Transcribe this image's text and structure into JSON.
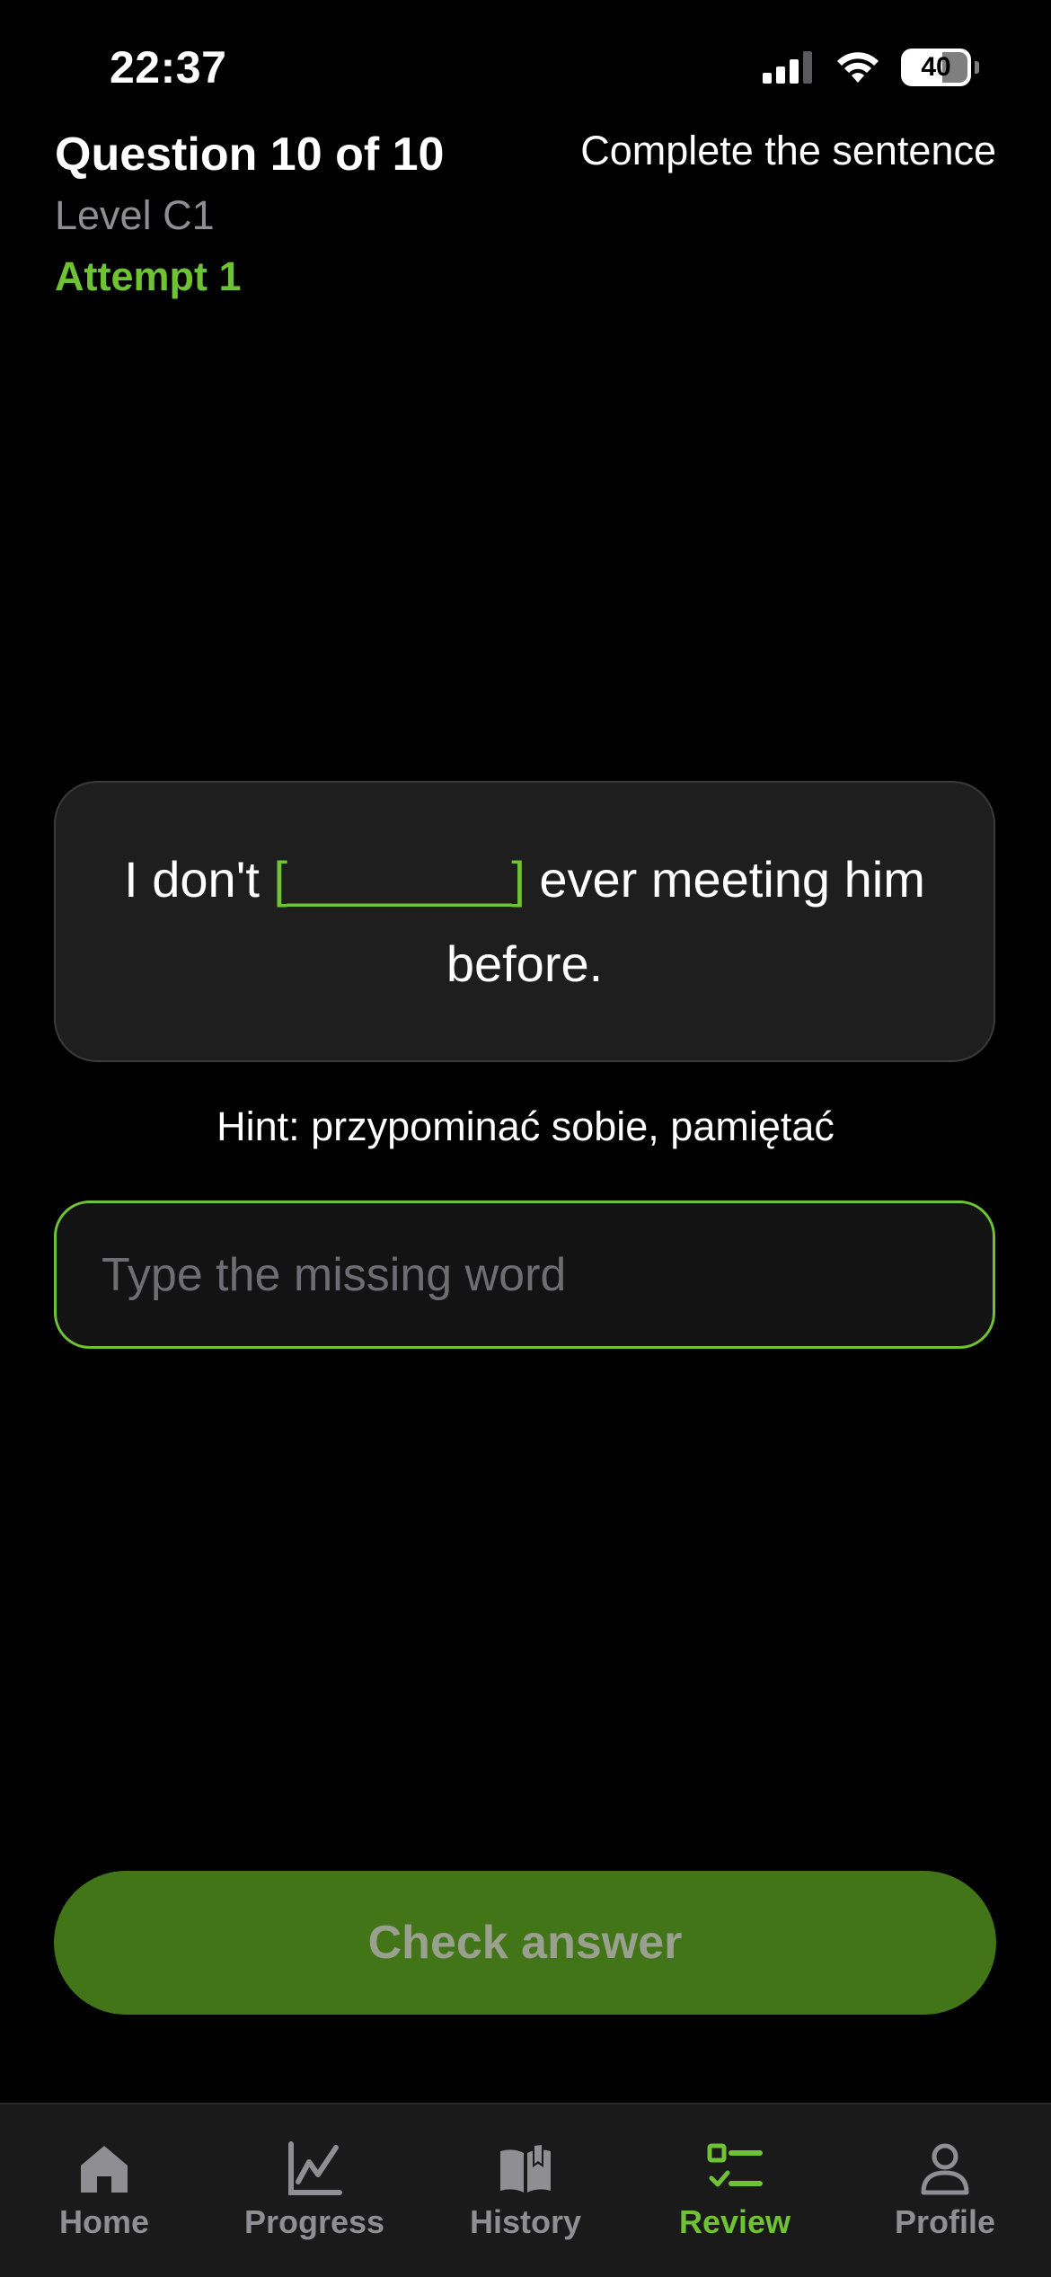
{
  "status_bar": {
    "time": "22:37",
    "battery": "40"
  },
  "header": {
    "question_progress": "Question 10 of 10",
    "exercise_type": "Complete the sentence",
    "level": "Level C1",
    "attempt": "Attempt 1"
  },
  "sentence": {
    "before_blank": "I don't ",
    "blank": "[________]",
    "after_blank": " ever meeting him before."
  },
  "hint": "Hint: przypominać sobie, pamiętać",
  "answer": {
    "value": "",
    "placeholder": "Type the missing word"
  },
  "check_button_label": "Check answer",
  "tabs": [
    {
      "label": "Home",
      "icon": "home-icon",
      "active": false
    },
    {
      "label": "Progress",
      "icon": "chart-icon",
      "active": false
    },
    {
      "label": "History",
      "icon": "book-icon",
      "active": false
    },
    {
      "label": "Review",
      "icon": "checklist-icon",
      "active": true
    },
    {
      "label": "Profile",
      "icon": "person-icon",
      "active": false
    }
  ],
  "colors": {
    "accent": "#6ec233",
    "button_bg": "#427518",
    "inactive_tab": "#8e8e93"
  }
}
